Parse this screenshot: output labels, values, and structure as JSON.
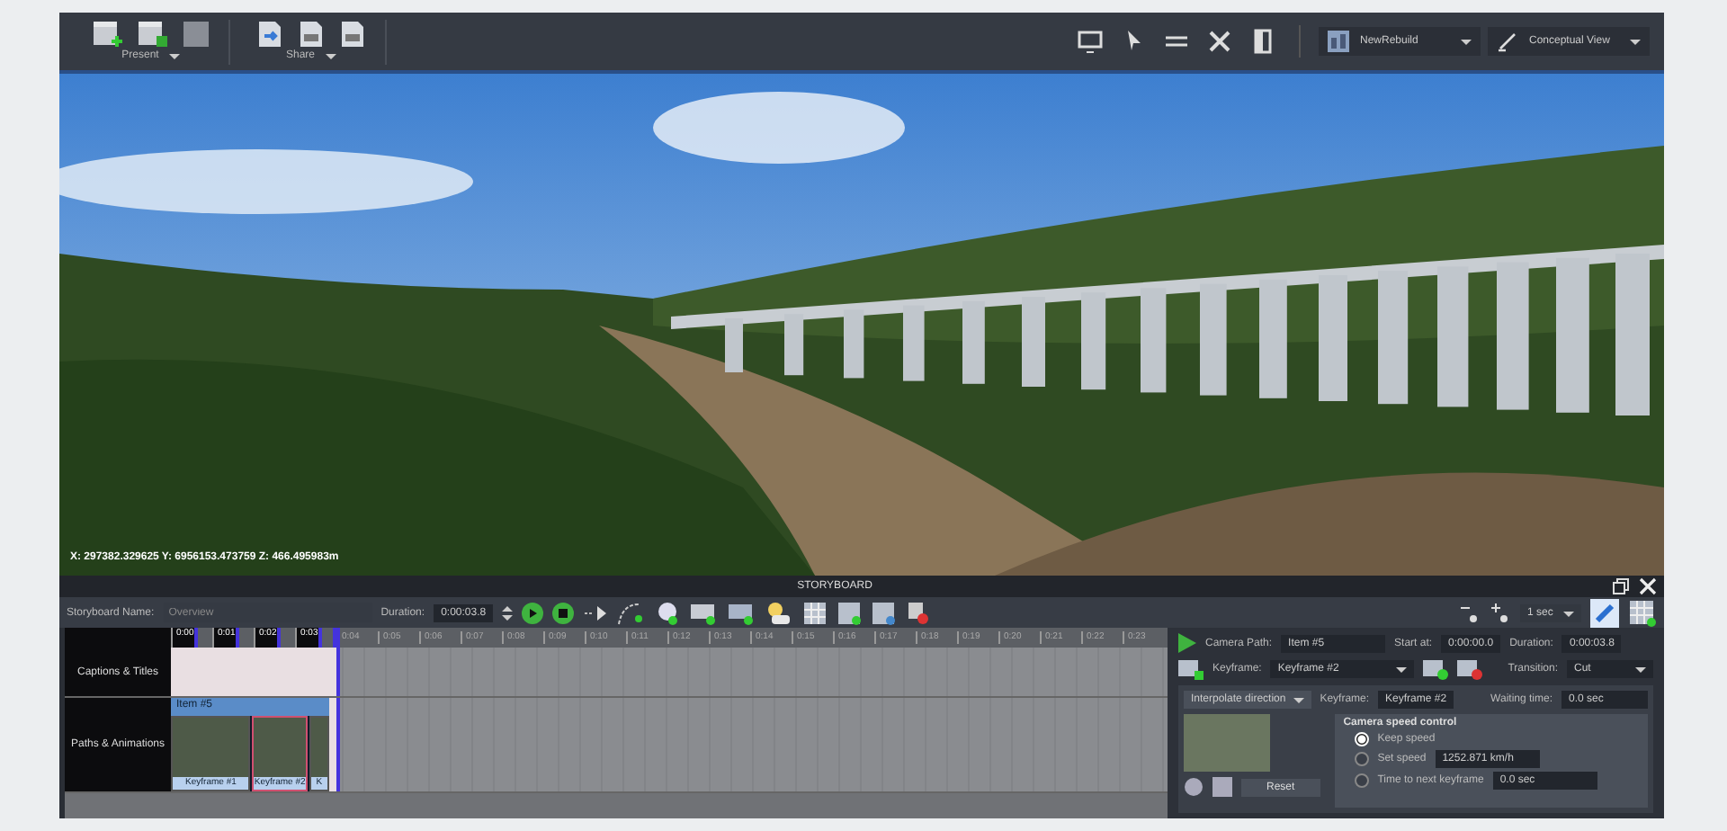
{
  "toolbar": {
    "groups": [
      {
        "label": "Present"
      },
      {
        "label": "Share"
      }
    ],
    "dropdowns": [
      {
        "kind": "model",
        "value": "NewRebuild"
      },
      {
        "kind": "view",
        "value": "Conceptual View"
      }
    ]
  },
  "viewport": {
    "coordinates": "X: 297382.329625 Y: 6956153.473759 Z: 466.495983m"
  },
  "storyboard": {
    "title": "STORYBOARD",
    "name_label": "Storyboard Name:",
    "name_placeholder": "Overview",
    "duration_label": "Duration:",
    "duration": "0:00:03.8",
    "zoom_step": "1 sec",
    "edit_mode": true,
    "ticks": [
      "0:00",
      "0:01",
      "0:02",
      "0:03",
      "0:04",
      "0:05",
      "0:06",
      "0:07",
      "0:08",
      "0:09",
      "0:10",
      "0:11",
      "0:12",
      "0:13",
      "0:14",
      "0:15",
      "0:16",
      "0:17",
      "0:18",
      "0:19",
      "0:20",
      "0:21",
      "0:22",
      "0:23"
    ],
    "tracks": [
      {
        "kind": "captions",
        "label": "Captions & Titles"
      },
      {
        "kind": "paths",
        "label": "Paths & Animations",
        "item": "Item #5",
        "keyframes": [
          {
            "label": "Keyframe #1",
            "selected": false
          },
          {
            "label": "Keyframe #2",
            "selected": true
          },
          {
            "label": "K",
            "selected": false
          }
        ]
      }
    ],
    "details": {
      "camera_path_label": "Camera Path:",
      "camera_path": "Item #5",
      "start_label": "Start at:",
      "start": "0:00:00.0",
      "duration_label": "Duration:",
      "duration": "0:00:03.8",
      "keyframe_label": "Keyframe:",
      "keyframe": "Keyframe #2",
      "transition_label": "Transition:",
      "transition": "Cut",
      "interpolate": "Interpolate direction",
      "keyframe_name_label": "Keyframe:",
      "keyframe_name": "Keyframe #2",
      "waiting_label": "Waiting time:",
      "waiting": "0.0 sec",
      "reset": "Reset",
      "speed_title": "Camera speed control",
      "speed_options": [
        {
          "label": "Keep speed",
          "selected": true
        },
        {
          "label": "Set speed",
          "value": "1252.871 km/h",
          "selected": false
        },
        {
          "label": "Time to next keyframe",
          "value": "0.0 sec",
          "selected": false
        }
      ]
    }
  }
}
